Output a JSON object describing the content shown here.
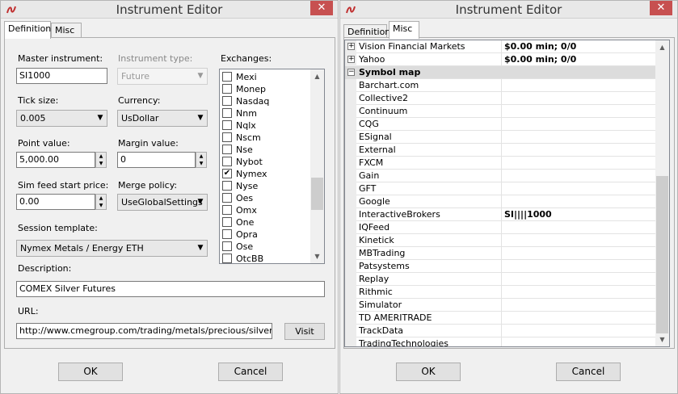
{
  "left": {
    "title": "Instrument Editor",
    "tabs": [
      "Definition",
      "Misc"
    ],
    "master_instrument": {
      "label": "Master instrument:",
      "value": "SI1000"
    },
    "instrument_type": {
      "label": "Instrument type:",
      "value": "Future"
    },
    "tick_size": {
      "label": "Tick size:",
      "value": "0.005"
    },
    "currency": {
      "label": "Currency:",
      "value": "UsDollar"
    },
    "point_value": {
      "label": "Point value:",
      "value": "5,000.00"
    },
    "margin_value": {
      "label": "Margin value:",
      "value": "0"
    },
    "sim_feed": {
      "label": "Sim feed start price:",
      "value": "0.00"
    },
    "merge_policy": {
      "label": "Merge policy:",
      "value": "UseGlobalSettings"
    },
    "session_template": {
      "label": "Session template:",
      "value": "Nymex Metals / Energy ETH"
    },
    "description": {
      "label": "Description:",
      "value": "COMEX Silver Futures"
    },
    "url": {
      "label": "URL:",
      "value": "http://www.cmegroup.com/trading/metals/precious/silver_contra"
    },
    "visit_label": "Visit",
    "exchanges": {
      "label": "Exchanges:",
      "items": [
        {
          "name": "Mexi",
          "checked": false
        },
        {
          "name": "Monep",
          "checked": false
        },
        {
          "name": "Nasdaq",
          "checked": false
        },
        {
          "name": "Nnm",
          "checked": false
        },
        {
          "name": "Nqlx",
          "checked": false
        },
        {
          "name": "Nscm",
          "checked": false
        },
        {
          "name": "Nse",
          "checked": false
        },
        {
          "name": "Nybot",
          "checked": false
        },
        {
          "name": "Nymex",
          "checked": true
        },
        {
          "name": "Nyse",
          "checked": false
        },
        {
          "name": "Oes",
          "checked": false
        },
        {
          "name": "Omx",
          "checked": false
        },
        {
          "name": "One",
          "checked": false
        },
        {
          "name": "Opra",
          "checked": false
        },
        {
          "name": "Ose",
          "checked": false
        },
        {
          "name": "OtcBB",
          "checked": false
        }
      ]
    },
    "ok_label": "OK",
    "cancel_label": "Cancel"
  },
  "right": {
    "title": "Instrument Editor",
    "tabs": [
      "Definition",
      "Misc"
    ],
    "rows": [
      {
        "type": "item",
        "expander": "+",
        "name": "Vision Financial Markets",
        "value": "$0.00 min;  0/0"
      },
      {
        "type": "item",
        "expander": "+",
        "name": "Yahoo",
        "value": "$0.00 min;  0/0"
      },
      {
        "type": "category",
        "expander": "−",
        "name": "Symbol map",
        "value": ""
      },
      {
        "type": "prop",
        "name": "Barchart.com",
        "value": ""
      },
      {
        "type": "prop",
        "name": "Collective2",
        "value": ""
      },
      {
        "type": "prop",
        "name": "Continuum",
        "value": ""
      },
      {
        "type": "prop",
        "name": "CQG",
        "value": ""
      },
      {
        "type": "prop",
        "name": "ESignal",
        "value": ""
      },
      {
        "type": "prop",
        "name": "External",
        "value": ""
      },
      {
        "type": "prop",
        "name": "FXCM",
        "value": ""
      },
      {
        "type": "prop",
        "name": "Gain",
        "value": ""
      },
      {
        "type": "prop",
        "name": "GFT",
        "value": ""
      },
      {
        "type": "prop",
        "name": "Google",
        "value": ""
      },
      {
        "type": "prop",
        "name": "InteractiveBrokers",
        "value": "SI||||1000"
      },
      {
        "type": "prop",
        "name": "IQFeed",
        "value": ""
      },
      {
        "type": "prop",
        "name": "Kinetick",
        "value": ""
      },
      {
        "type": "prop",
        "name": "MBTrading",
        "value": ""
      },
      {
        "type": "prop",
        "name": "Patsystems",
        "value": ""
      },
      {
        "type": "prop",
        "name": "Replay",
        "value": ""
      },
      {
        "type": "prop",
        "name": "Rithmic",
        "value": ""
      },
      {
        "type": "prop",
        "name": "Simulator",
        "value": ""
      },
      {
        "type": "prop",
        "name": "TD AMERITRADE",
        "value": ""
      },
      {
        "type": "prop",
        "name": "TrackData",
        "value": ""
      },
      {
        "type": "prop",
        "name": "TradingTechnologies",
        "value": ""
      }
    ],
    "ok_label": "OK",
    "cancel_label": "Cancel"
  },
  "icons": {
    "close": "close-icon",
    "app": "ninja-logo-icon",
    "dropdown": "chevron-down-icon",
    "spin_up": "spin-up-icon",
    "spin_down": "spin-down-icon"
  },
  "colors": {
    "close_button": "#c75050",
    "category_row": "#dcdcdc"
  }
}
